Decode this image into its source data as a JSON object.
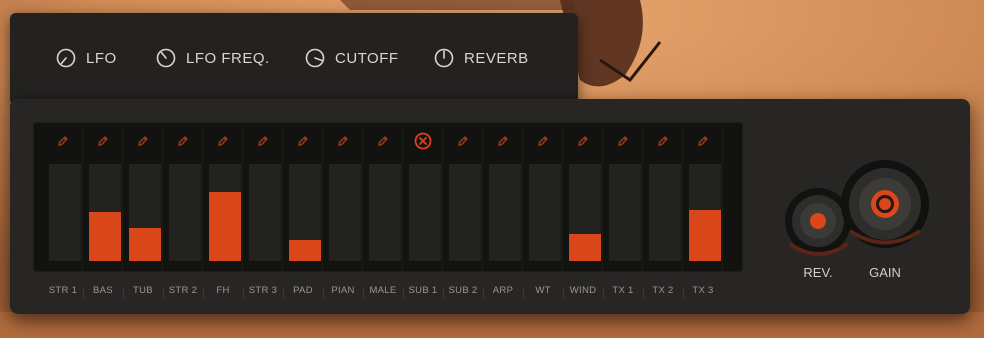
{
  "top_controls": [
    {
      "label": "LFO",
      "icon": "knob-icon"
    },
    {
      "label": "LFO FREQ.",
      "icon": "knob-icon"
    },
    {
      "label": "CUTOFF",
      "icon": "knob-icon"
    },
    {
      "label": "REVERB",
      "icon": "knob-icon"
    }
  ],
  "channels": [
    {
      "label": "STR 1",
      "level": 0.0,
      "edit_icon": "pencil-icon"
    },
    {
      "label": "BAS",
      "level": 0.51,
      "edit_icon": "pencil-icon"
    },
    {
      "label": "TUB",
      "level": 0.34,
      "edit_icon": "pencil-icon"
    },
    {
      "label": "STR 2",
      "level": 0.0,
      "edit_icon": "pencil-icon"
    },
    {
      "label": "FH",
      "level": 0.71,
      "edit_icon": "pencil-icon"
    },
    {
      "label": "STR 3",
      "level": 0.0,
      "edit_icon": "pencil-icon"
    },
    {
      "label": "PAD",
      "level": 0.22,
      "edit_icon": "pencil-icon"
    },
    {
      "label": "PIAN",
      "level": 0.0,
      "edit_icon": "pencil-icon"
    },
    {
      "label": "MALE",
      "level": 0.0,
      "edit_icon": "pencil-icon"
    },
    {
      "label": "SUB 1",
      "level": 0.0,
      "edit_icon": "close-circle-icon"
    },
    {
      "label": "SUB 2",
      "level": 0.0,
      "edit_icon": "pencil-icon"
    },
    {
      "label": "ARP",
      "level": 0.0,
      "edit_icon": "pencil-icon"
    },
    {
      "label": "WT",
      "level": 0.0,
      "edit_icon": "pencil-icon"
    },
    {
      "label": "WIND",
      "level": 0.28,
      "edit_icon": "pencil-icon"
    },
    {
      "label": "TX 1",
      "level": 0.0,
      "edit_icon": "pencil-icon"
    },
    {
      "label": "TX 2",
      "level": 0.0,
      "edit_icon": "pencil-icon"
    },
    {
      "label": "TX 3",
      "level": 0.53,
      "edit_icon": "pencil-icon"
    }
  ],
  "rev_knob": {
    "label": "REV."
  },
  "gain_knob": {
    "label": "GAIN"
  },
  "colors": {
    "accent": "#d9471a",
    "panel": "#272625",
    "slot": "#22231f",
    "active_icon": "#e0401c"
  }
}
